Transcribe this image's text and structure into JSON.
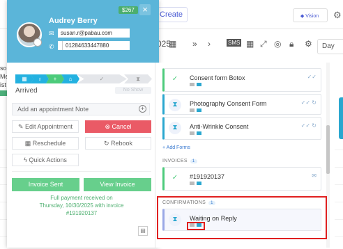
{
  "topbar": {
    "create_label": "Create",
    "vision_label": "Vision"
  },
  "toolbar": {
    "date_suffix": "025",
    "view_label": "Day"
  },
  "background_left": {
    "lines": [
      "so",
      "Me",
      "ist"
    ]
  },
  "client": {
    "name": "Audrey Berry",
    "email": "susan.r@pabau.com",
    "phone": "01284633447880",
    "price_badge": "$267"
  },
  "status": {
    "label": "Arrived",
    "pill": "No Show"
  },
  "note": {
    "placeholder": "Add an appointment Note"
  },
  "actions": {
    "edit": "Edit Appointment",
    "cancel": "Cancel",
    "reschedule": "Reschedule",
    "rebook": "Rebook",
    "quick": "Quick Actions"
  },
  "invoice": {
    "sent_label": "Invoice Sent",
    "view_label": "View Invoice",
    "payment_line1": "Full payment received on",
    "payment_line2": "Thursday, 10/30/2025 with invoice",
    "payment_line3": "#191920137"
  },
  "forms": [
    {
      "title": "Consent form Botox",
      "state": "done"
    },
    {
      "title": "Photography Consent Form",
      "state": "pending"
    },
    {
      "title": "Anti-Wrinkle Consent",
      "state": "pending"
    }
  ],
  "add_forms_label": "+ Add Forms",
  "invoices_section": {
    "label": "INVOICES",
    "count": "1",
    "item": "#191920137"
  },
  "confirmations_section": {
    "label": "CONFIRMATIONS",
    "count": "1",
    "item": "Waiting on Reply"
  },
  "colors": {
    "header": "#5bb5d9",
    "cancel": "#ea5a66",
    "green": "#67cf8c",
    "highlight": "#e02020"
  }
}
